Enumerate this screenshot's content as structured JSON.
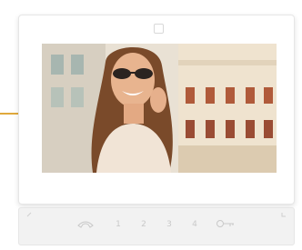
{
  "keypad": {
    "buttons": [
      "1",
      "2",
      "3",
      "4"
    ]
  },
  "colors": {
    "accent_line": "#e0a93c",
    "bezel": "#ffffff",
    "strip": "#f2f2f2",
    "glyph": "#c9c9c9"
  },
  "icons": {
    "talk": "handset-icon",
    "unlock": "key-icon",
    "camera": "camera-icon"
  }
}
